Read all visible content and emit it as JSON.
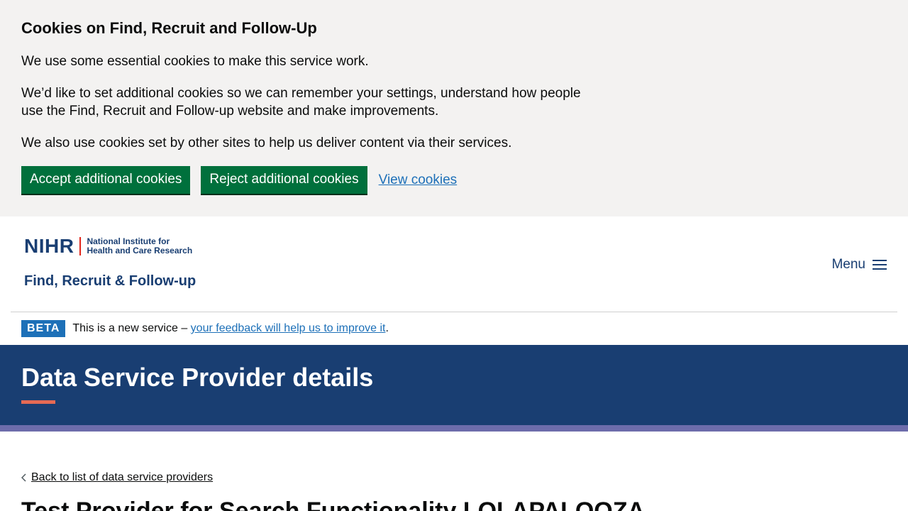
{
  "cookie_banner": {
    "title": "Cookies on Find, Recruit and Follow-Up",
    "p1": "We use some essential cookies to make this service work.",
    "p2": "We’d like to set additional cookies so we can remember your settings, understand how people use the Find, Recruit and Follow-up website and make improvements.",
    "p3": "We also use cookies set by other sites to help us deliver content via their services.",
    "accept_label": "Accept additional cookies",
    "reject_label": "Reject additional cookies",
    "view_label": "View cookies"
  },
  "header": {
    "logo_abbr": "NIHR",
    "logo_line1": "National Institute for",
    "logo_line2": "Health and Care Research",
    "service_name": "Find, Recruit & Follow-up",
    "menu_label": "Menu",
    "menu_icon": "hamburger-icon"
  },
  "phase_banner": {
    "tag": "BETA",
    "text": "This is a new service – ",
    "link": "your feedback will help us to improve it",
    "suffix": "."
  },
  "page": {
    "title": "Data Service Provider details"
  },
  "content": {
    "back_label": "Back to list of data service providers",
    "provider_title": "Test Provider for Search Functionality LOLAPALOOZA"
  },
  "colors": {
    "banner_bg": "#f3f2f1",
    "button_green": "#00703c",
    "link_blue": "#1d70b8",
    "navy": "#193e72",
    "accent_red": "#e56a54",
    "strip_purple": "#6d6cab"
  }
}
